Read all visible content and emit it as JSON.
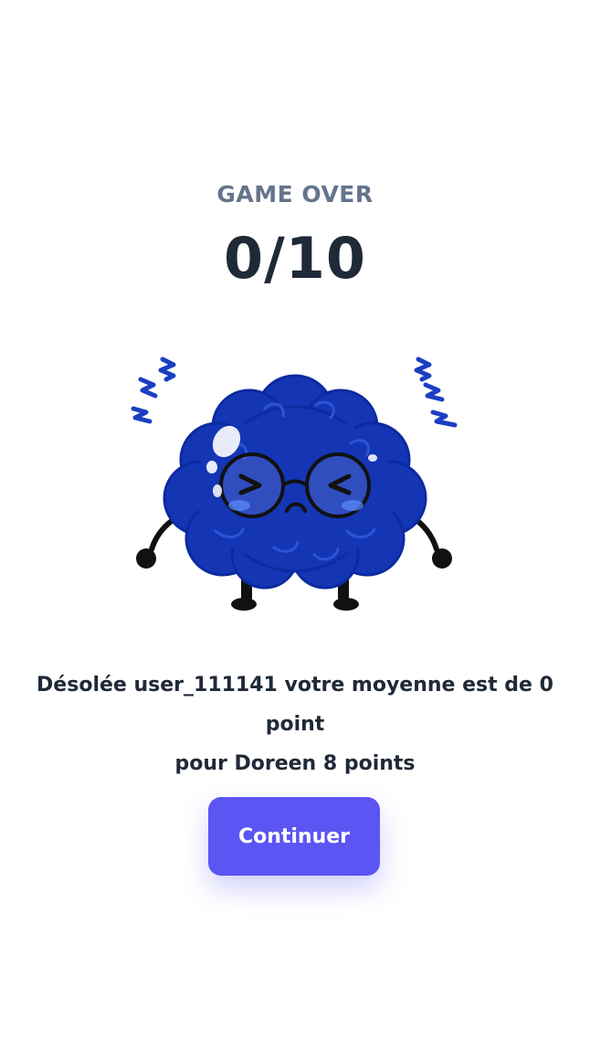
{
  "result": {
    "header_label": "GAME OVER",
    "score": "0/10"
  },
  "mascot": {
    "icon": "sad-brain-icon",
    "color": "#1436b5"
  },
  "message": {
    "line1": "Désolée user_111141 votre moyenne est de 0 point",
    "line2": "pour Doreen 8 points"
  },
  "actions": {
    "continue_label": "Continuer",
    "accent_color": "#5b55f4"
  }
}
